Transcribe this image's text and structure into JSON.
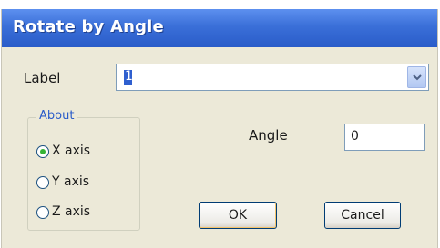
{
  "window": {
    "title": "Rotate by Angle"
  },
  "label_field": {
    "label": "Label",
    "value": "1"
  },
  "about_group": {
    "legend": "About",
    "options": [
      {
        "label": "X axis",
        "selected": true
      },
      {
        "label": "Y axis",
        "selected": false
      },
      {
        "label": "Z axis",
        "selected": false
      }
    ]
  },
  "angle_field": {
    "label": "Angle",
    "value": "0"
  },
  "buttons": {
    "ok": "OK",
    "cancel": "Cancel"
  },
  "colors": {
    "titlebar": "#2a5cc9",
    "dialog_bg": "#ece9d8",
    "radio_selected": "#35b335"
  }
}
